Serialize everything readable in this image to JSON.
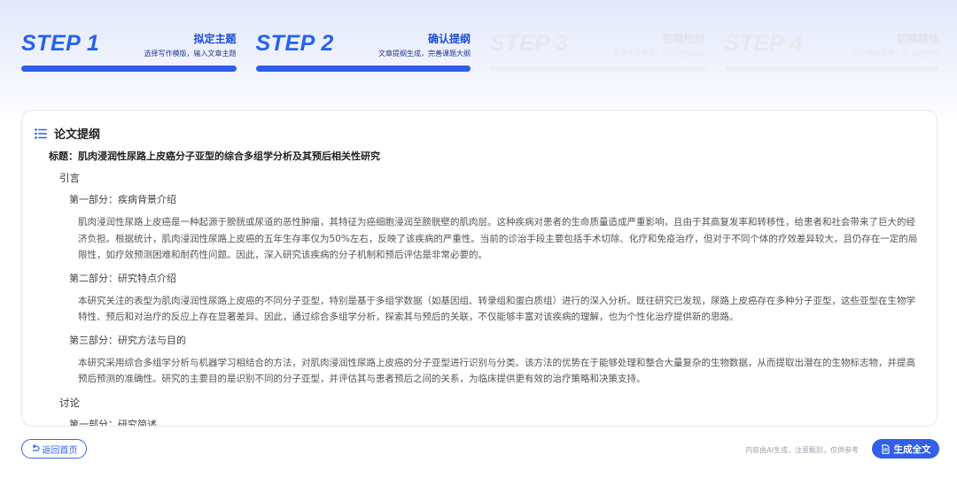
{
  "steps": [
    {
      "label": "STEP 1",
      "title": "拟定主题",
      "subtitle": "选择写作模版，输入文章主题",
      "state": "active"
    },
    {
      "label": "STEP 2",
      "title": "确认提纲",
      "subtitle": "文章提纲生成，完善课题大纲",
      "state": "active"
    },
    {
      "label": "STEP 3",
      "title": "初稿校对",
      "subtitle": "文章全文撰写，核实内容校对",
      "state": "inactive"
    },
    {
      "label": "STEP 4",
      "title": "初稿精修",
      "subtitle": "全文精修处理，AI 润色修饰",
      "state": "inactive"
    }
  ],
  "outline": {
    "heading": "论文提纲",
    "icon": "list-icon",
    "title": "标题：肌肉浸润性尿路上皮癌分子亚型的综合多组学分析及其预后相关性研究",
    "intro": {
      "label": "引言",
      "part1": {
        "label": "第一部分：疾病背景介绍",
        "text": "肌肉浸润性尿路上皮癌是一种起源于膀胱或尿道的恶性肿瘤，其特征为癌细胞浸润至膀胱壁的肌肉层。这种疾病对患者的生命质量造成严重影响，且由于其高复发率和转移性，给患者和社会带来了巨大的经济负担。根据统计，肌肉浸润性尿路上皮癌的五年生存率仅为50%左右，反映了该疾病的严重性。当前的诊治手段主要包括手术切除、化疗和免疫治疗，但对于不同个体的疗效差异较大，且仍存在一定的局限性，如疗效预测困难和耐药性问题。因此，深入研究该疾病的分子机制和预后评估是非常必要的。"
      },
      "part2": {
        "label": "第二部分：研究特点介绍",
        "text": "本研究关注的表型为肌肉浸润性尿路上皮癌的不同分子亚型，特别是基于多组学数据（如基因组、转录组和蛋白质组）进行的深入分析。既往研究已发现，尿路上皮癌存在多种分子亚型，这些亚型在生物学特性、预后和对治疗的反应上存在显著差异。因此，通过综合多组学分析，探索其与预后的关联，不仅能够丰富对该疾病的理解，也为个性化治疗提供新的思路。"
      },
      "part3": {
        "label": "第三部分：研究方法与目的",
        "text": "本研究采用综合多组学分析与机器学习相结合的方法，对肌肉浸润性尿路上皮癌的分子亚型进行识别与分类。该方法的优势在于能够处理和整合大量复杂的生物数据，从而提取出潜在的生物标志物，并提高预后预测的准确性。研究的主要目的是识别不同的分子亚型，并评估其与患者预后之间的关系，为临床提供更有效的治疗策略和决策支持。"
      }
    },
    "discussion": {
      "label": "讨论",
      "part1": {
        "label": "第一部分：研究简述"
      }
    }
  },
  "footer": {
    "back_label": "返回首页",
    "back_icon": "return-icon",
    "disclaimer": "内容由AI生成，注意甄别，仅供参考",
    "generate_label": "生成全文",
    "generate_icon": "document-icon"
  },
  "colors": {
    "accent": "#2f5ee8",
    "inactive": "#edeff4"
  }
}
